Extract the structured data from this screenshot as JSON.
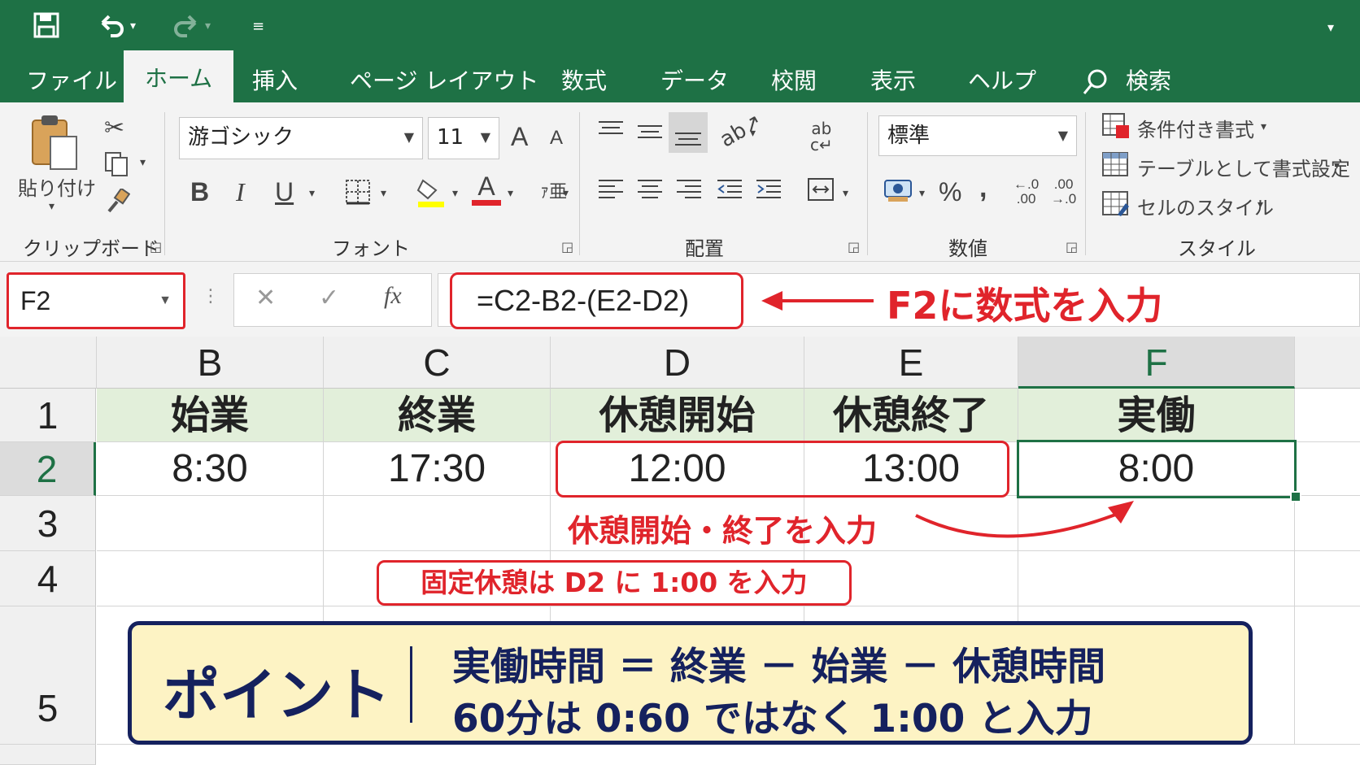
{
  "qat": {
    "save_icon": "save-icon",
    "undo_icon": "undo-icon",
    "redo_icon": "redo-icon",
    "customize_icon": "customize-qat-icon"
  },
  "tabs": [
    {
      "label": "ファイル"
    },
    {
      "label": "ホーム",
      "active": true
    },
    {
      "label": "挿入"
    },
    {
      "label": "ページ レイアウト"
    },
    {
      "label": "数式"
    },
    {
      "label": "データ"
    },
    {
      "label": "校閲"
    },
    {
      "label": "表示"
    },
    {
      "label": "ヘルプ"
    },
    {
      "label": "検索"
    }
  ],
  "ribbon": {
    "clipboard": {
      "paste_label": "貼り付け",
      "group_label": "クリップボード"
    },
    "font": {
      "font_name": "游ゴシック",
      "font_size": "11",
      "bold": "B",
      "italic": "I",
      "underline": "U",
      "grow": "A",
      "shrink": "A",
      "font_color_glyph": "A",
      "group_label": "フォント",
      "highlight_color": "#ffff00",
      "font_color": "#e0242b"
    },
    "alignment": {
      "group_label": "配置"
    },
    "number": {
      "format": "標準",
      "percent": "%",
      "comma": ",",
      "inc_decimal": "←.0\n.00",
      "dec_decimal": ".00\n→.0",
      "group_label": "数値"
    },
    "styles": {
      "conditional": "条件付き書式",
      "table": "テーブルとして書式設定",
      "cell_styles": "セルのスタイル",
      "group_label": "スタイル"
    }
  },
  "formula_bar": {
    "name_box": "F2",
    "cancel": "✕",
    "enter": "✓",
    "fx": "fx",
    "formula": "=C2-B2-(E2-D2)"
  },
  "annotations": {
    "formula_callout": "F2に数式を入力",
    "break_callout": "休憩開始・終了を入力",
    "fixed_break_note": "固定休憩は D2 に 1:00 を入力"
  },
  "sheet": {
    "columns": [
      "B",
      "C",
      "D",
      "E",
      "F"
    ],
    "selected_column": "F",
    "rows": [
      "1",
      "2",
      "3",
      "4",
      "5"
    ],
    "selected_row": "2",
    "header_row": [
      "始業",
      "終業",
      "休憩開始",
      "休憩終了",
      "実働"
    ],
    "data_row": [
      "8:30",
      "17:30",
      "12:00",
      "13:00",
      "8:00"
    ],
    "header_fill": "#e2efda",
    "selected_cell": "F2"
  },
  "point": {
    "title": "ポイント",
    "line1": "実働時間 ＝ 終業 － 始業 － 休憩時間",
    "line2": "60分は 0:60 ではなく 1:00 と入力"
  },
  "colors": {
    "excel_green": "#1e7145",
    "annotation_red": "#e0242b",
    "point_navy": "#15215e",
    "point_fill": "#fdf3c4"
  }
}
